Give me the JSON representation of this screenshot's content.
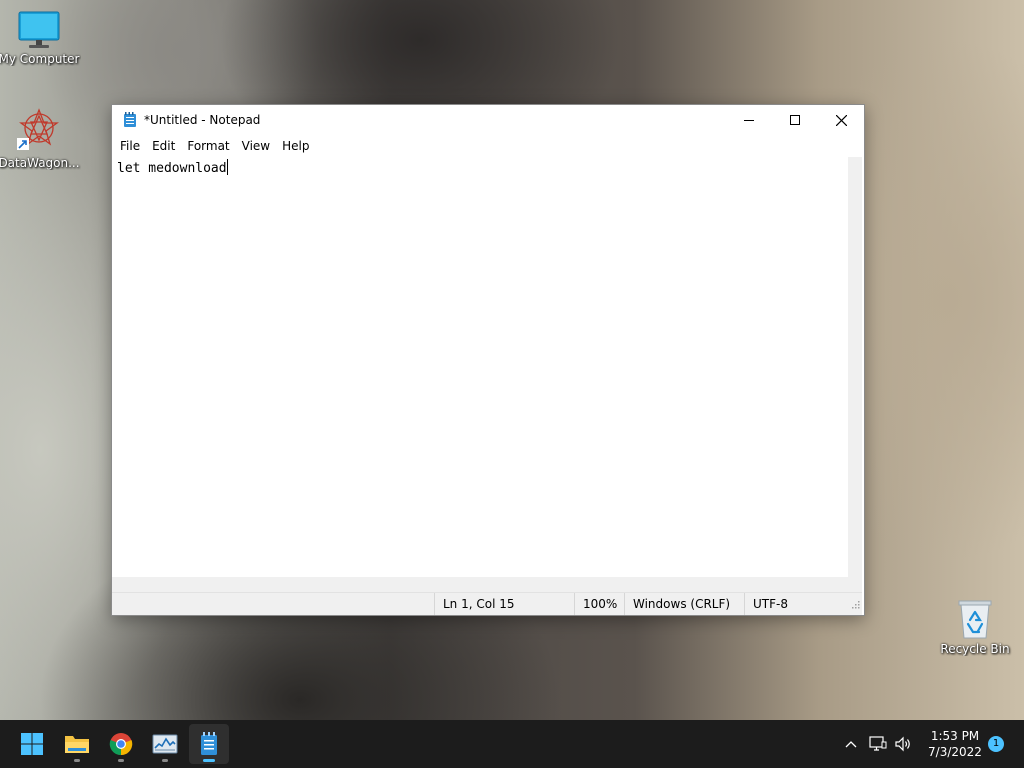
{
  "desktop": {
    "icons": [
      {
        "label": "My Computer"
      },
      {
        "label": "DataWagon..."
      },
      {
        "label": "Recycle Bin"
      }
    ]
  },
  "window": {
    "title": "*Untitled - Notepad",
    "menu": [
      "File",
      "Edit",
      "Format",
      "View",
      "Help"
    ],
    "content": "let medownload",
    "status": {
      "position": "Ln 1, Col 15",
      "zoom": "100%",
      "line_ending": "Windows (CRLF)",
      "encoding": "UTF-8"
    }
  },
  "taskbar": {
    "apps": [
      "start",
      "file-explorer",
      "chrome",
      "task-manager",
      "notepad"
    ],
    "active_app": "notepad",
    "clock_time": "1:53 PM",
    "clock_date": "7/3/2022",
    "notification_count": "1"
  },
  "colors": {
    "accent": "#4cc2ff",
    "taskbar_bg": "#1c1c1c",
    "folder_yellow": "#f4c343"
  }
}
